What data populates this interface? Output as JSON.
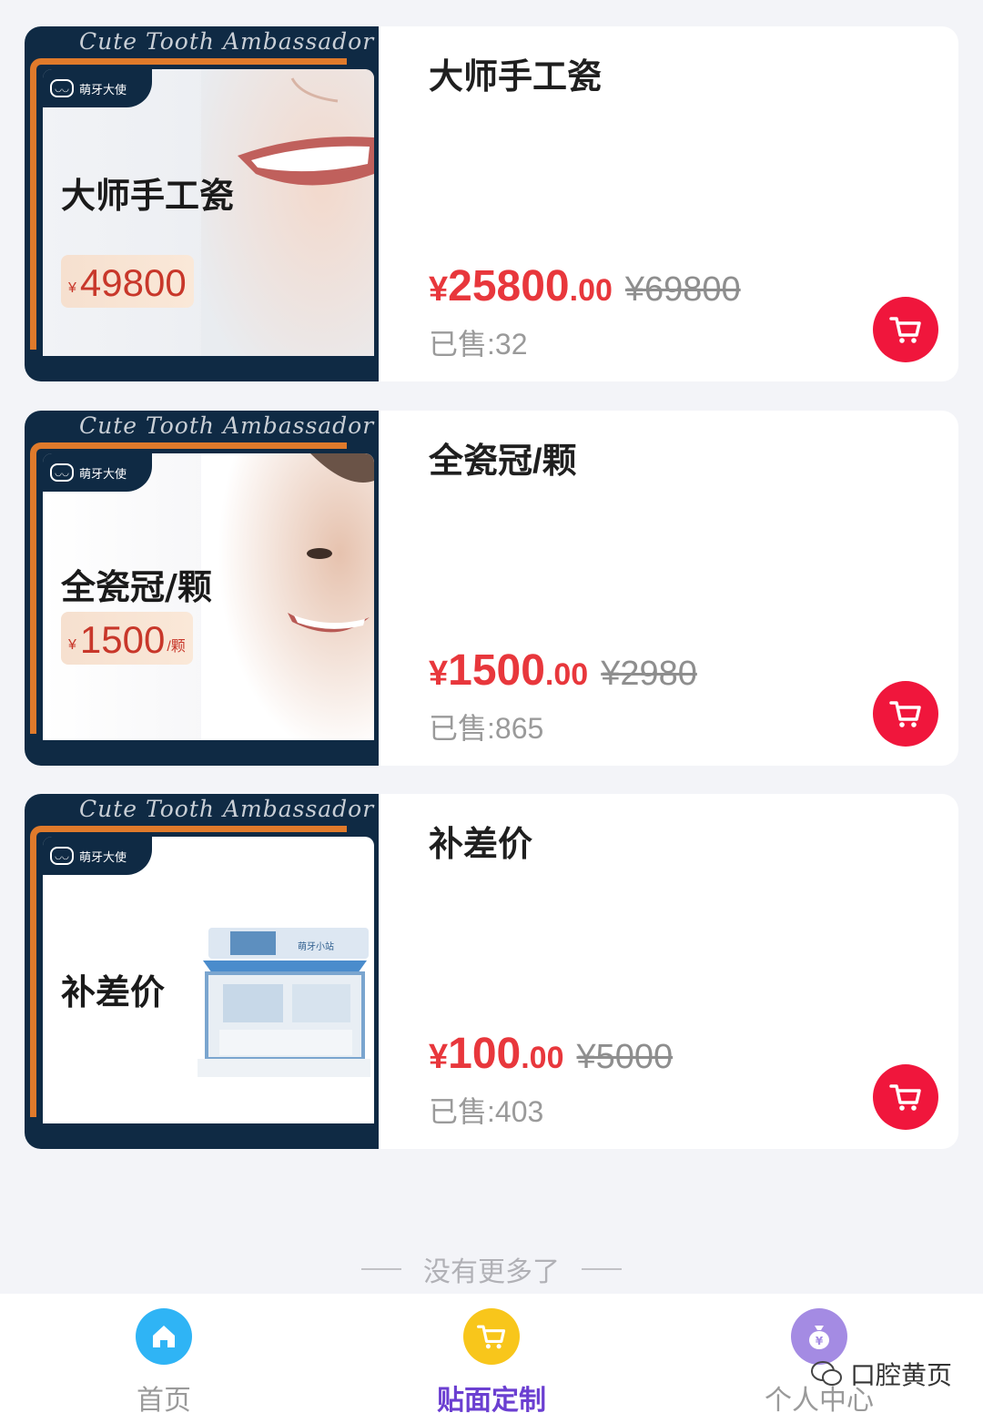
{
  "products": [
    {
      "banner_script": "Cute Tooth Ambassador",
      "banner_brand": "萌牙大使",
      "banner_title": "大师手工瓷",
      "banner_price_symbol": "¥",
      "banner_price": "49800",
      "banner_unit": "",
      "name": "大师手工瓷",
      "price_symbol": "¥",
      "price_int": "25800",
      "price_dec": ".00",
      "original_price": "¥69800",
      "sold": "已售:32",
      "cart_icon": "cart-icon"
    },
    {
      "banner_script": "Cute Tooth Ambassador",
      "banner_brand": "萌牙大使",
      "banner_title": "全瓷冠/颗",
      "banner_price_symbol": "¥",
      "banner_price": "1500",
      "banner_unit": "/颗",
      "name": "全瓷冠/颗",
      "price_symbol": "¥",
      "price_int": "1500",
      "price_dec": ".00",
      "original_price": "¥2980",
      "sold": "已售:865",
      "cart_icon": "cart-icon"
    },
    {
      "banner_script": "Cute Tooth Ambassador",
      "banner_brand": "萌牙大使",
      "banner_title": "补差价",
      "banner_store_text": "萌牙小站",
      "name": "补差价",
      "price_symbol": "¥",
      "price_int": "100",
      "price_dec": ".00",
      "original_price": "¥5000",
      "sold": "已售:403",
      "cart_icon": "cart-icon"
    }
  ],
  "footer_text": "没有更多了",
  "tabbar": {
    "items": [
      {
        "label": "首页",
        "icon": "home-icon",
        "color": "#2fb4f5",
        "active": false
      },
      {
        "label": "贴面定制",
        "icon": "cart-icon",
        "color": "#f8c61b",
        "active": true
      },
      {
        "label": "个人中心",
        "icon": "money-bag-icon",
        "color": "#a48be3",
        "active": false
      }
    ]
  },
  "watermark": "口腔黄页",
  "colors": {
    "accent_red": "#e8373c",
    "cart_button": "#f0163c",
    "active_tab": "#6b3fd1",
    "banner_navy": "#0f2a44",
    "banner_orange": "#e07a2b"
  }
}
